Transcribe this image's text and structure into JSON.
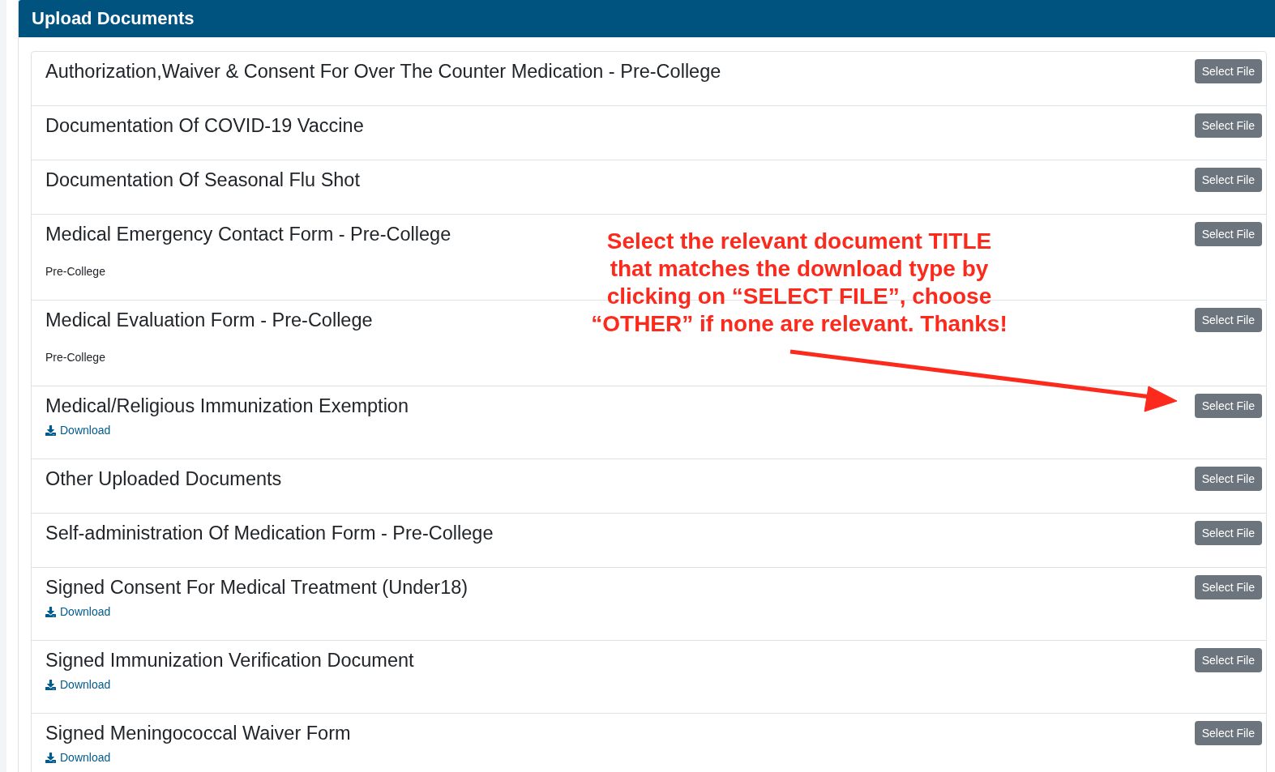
{
  "panel": {
    "title": "Upload Documents"
  },
  "documents": [
    {
      "kind": "plain",
      "title": "Authorization,Waiver & Consent For Over The Counter Medication - Pre-College",
      "button": "Select File"
    },
    {
      "kind": "plain",
      "title": "Documentation Of COVID-19 Vaccine",
      "button": "Select File"
    },
    {
      "kind": "plain",
      "title": "Documentation Of Seasonal Flu Shot",
      "button": "Select File"
    },
    {
      "kind": "note",
      "title": "Medical Emergency Contact Form - Pre-College",
      "note": "Pre-College",
      "button": "Select File"
    },
    {
      "kind": "note",
      "title": "Medical Evaluation Form - Pre-College",
      "note": "Pre-College",
      "button": "Select File"
    },
    {
      "kind": "download",
      "title": "Medical/Religious Immunization Exemption",
      "link": "Download",
      "button": "Select File"
    },
    {
      "kind": "plain",
      "title": "Other Uploaded Documents",
      "button": "Select File"
    },
    {
      "kind": "plain",
      "title": "Self-administration Of Medication Form - Pre-College",
      "button": "Select File"
    },
    {
      "kind": "download",
      "title": "Signed Consent For Medical Treatment (Under18)",
      "link": "Download",
      "button": "Select File"
    },
    {
      "kind": "download",
      "title": "Signed Immunization Verification Document",
      "link": "Download",
      "button": "Select File"
    },
    {
      "kind": "download",
      "title": "Signed Meningococcal Waiver Form",
      "link": "Download",
      "button": "Select File"
    }
  ],
  "annotation": {
    "text": "Select the relevant document TITLE\nthat matches the download type by\nclicking on “SELECT FILE”, choose\n“OTHER” if none are relevant. Thanks!"
  }
}
